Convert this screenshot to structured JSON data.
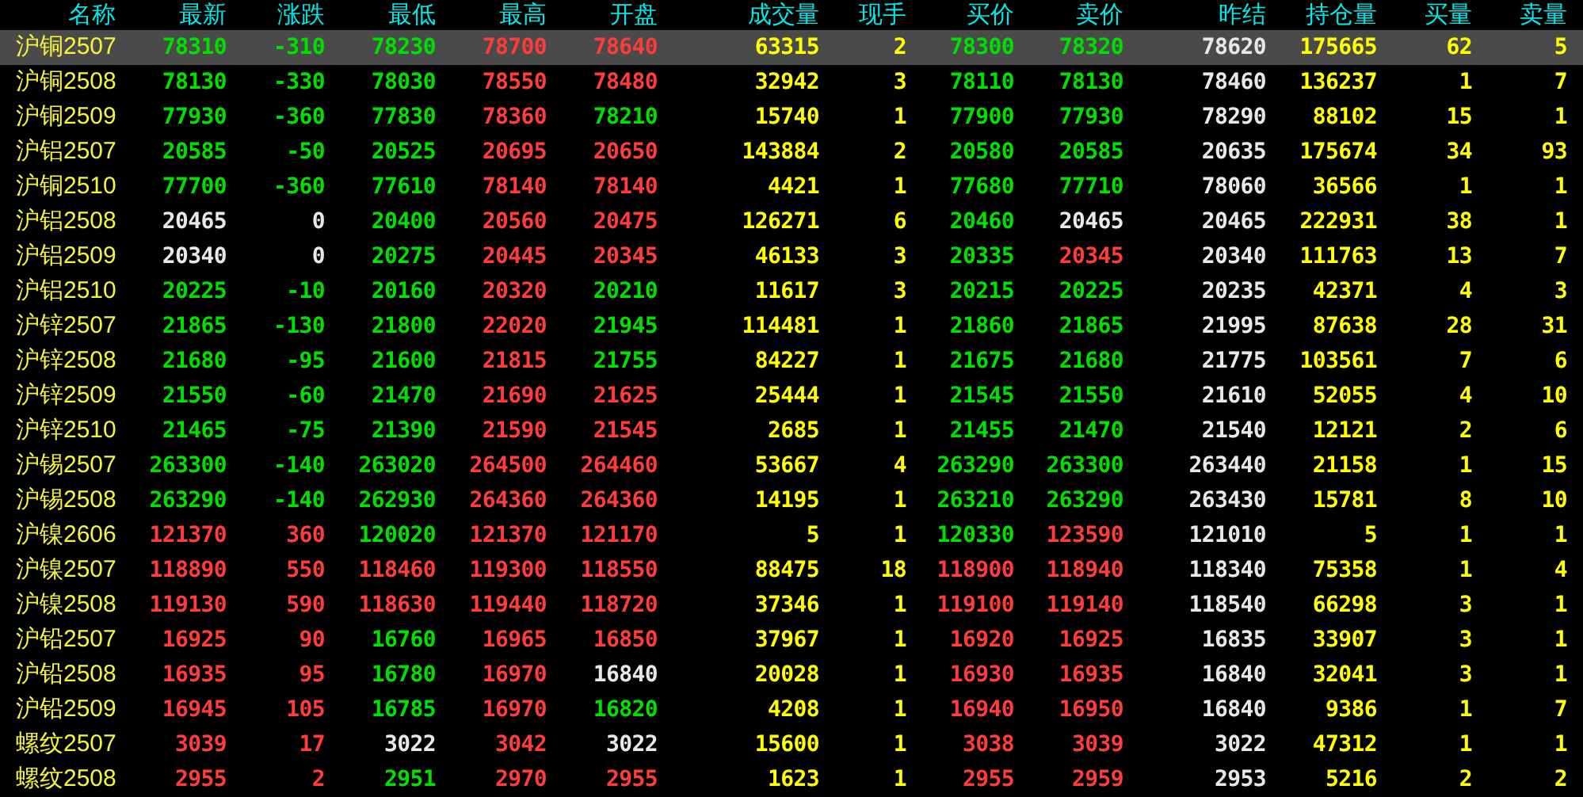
{
  "table": {
    "columns": [
      {
        "label": "名称",
        "kind": "name"
      },
      {
        "label": "最新",
        "kind": "price"
      },
      {
        "label": "涨跌",
        "kind": "change"
      },
      {
        "label": "最低",
        "kind": "price"
      },
      {
        "label": "最高",
        "kind": "price"
      },
      {
        "label": "开盘",
        "kind": "price"
      },
      {
        "label": "成交量",
        "kind": "volume"
      },
      {
        "label": "现手",
        "kind": "volume"
      },
      {
        "label": "买价",
        "kind": "price"
      },
      {
        "label": "卖价",
        "kind": "price"
      },
      {
        "label": "昨结",
        "kind": "settle"
      },
      {
        "label": "持仓量",
        "kind": "volume"
      },
      {
        "label": "买量",
        "kind": "volume"
      },
      {
        "label": "卖量",
        "kind": "volume"
      }
    ],
    "rows": [
      {
        "selected": true,
        "cells": [
          "沪铜2507",
          "78310",
          "-310",
          "78230",
          "78700",
          "78640",
          "63315",
          "2",
          "78300",
          "78320",
          "78620",
          "175665",
          "62",
          "5"
        ]
      },
      {
        "selected": false,
        "cells": [
          "沪铜2508",
          "78130",
          "-330",
          "78030",
          "78550",
          "78480",
          "32942",
          "3",
          "78110",
          "78130",
          "78460",
          "136237",
          "1",
          "7"
        ]
      },
      {
        "selected": false,
        "cells": [
          "沪铜2509",
          "77930",
          "-360",
          "77830",
          "78360",
          "78210",
          "15740",
          "1",
          "77900",
          "77930",
          "78290",
          "88102",
          "15",
          "1"
        ]
      },
      {
        "selected": false,
        "cells": [
          "沪铝2507",
          "20585",
          "-50",
          "20525",
          "20695",
          "20650",
          "143884",
          "2",
          "20580",
          "20585",
          "20635",
          "175674",
          "34",
          "93"
        ]
      },
      {
        "selected": false,
        "cells": [
          "沪铜2510",
          "77700",
          "-360",
          "77610",
          "78140",
          "78140",
          "4421",
          "1",
          "77680",
          "77710",
          "78060",
          "36566",
          "1",
          "1"
        ]
      },
      {
        "selected": false,
        "cells": [
          "沪铝2508",
          "20465",
          "0",
          "20400",
          "20560",
          "20475",
          "126271",
          "6",
          "20460",
          "20465",
          "20465",
          "222931",
          "38",
          "1"
        ]
      },
      {
        "selected": false,
        "cells": [
          "沪铝2509",
          "20340",
          "0",
          "20275",
          "20445",
          "20345",
          "46133",
          "3",
          "20335",
          "20345",
          "20340",
          "111763",
          "13",
          "7"
        ]
      },
      {
        "selected": false,
        "cells": [
          "沪铝2510",
          "20225",
          "-10",
          "20160",
          "20320",
          "20210",
          "11617",
          "3",
          "20215",
          "20225",
          "20235",
          "42371",
          "4",
          "3"
        ]
      },
      {
        "selected": false,
        "cells": [
          "沪锌2507",
          "21865",
          "-130",
          "21800",
          "22020",
          "21945",
          "114481",
          "1",
          "21860",
          "21865",
          "21995",
          "87638",
          "28",
          "31"
        ]
      },
      {
        "selected": false,
        "cells": [
          "沪锌2508",
          "21680",
          "-95",
          "21600",
          "21815",
          "21755",
          "84227",
          "1",
          "21675",
          "21680",
          "21775",
          "103561",
          "7",
          "6"
        ]
      },
      {
        "selected": false,
        "cells": [
          "沪锌2509",
          "21550",
          "-60",
          "21470",
          "21690",
          "21625",
          "25444",
          "1",
          "21545",
          "21550",
          "21610",
          "52055",
          "4",
          "10"
        ]
      },
      {
        "selected": false,
        "cells": [
          "沪锌2510",
          "21465",
          "-75",
          "21390",
          "21590",
          "21545",
          "2685",
          "1",
          "21455",
          "21470",
          "21540",
          "12121",
          "2",
          "6"
        ]
      },
      {
        "selected": false,
        "cells": [
          "沪锡2507",
          "263300",
          "-140",
          "263020",
          "264500",
          "264460",
          "53667",
          "4",
          "263290",
          "263300",
          "263440",
          "21158",
          "1",
          "15"
        ]
      },
      {
        "selected": false,
        "cells": [
          "沪锡2508",
          "263290",
          "-140",
          "262930",
          "264360",
          "264360",
          "14195",
          "1",
          "263210",
          "263290",
          "263430",
          "15781",
          "8",
          "10"
        ]
      },
      {
        "selected": false,
        "cells": [
          "沪镍2606",
          "121370",
          "360",
          "120020",
          "121370",
          "121170",
          "5",
          "1",
          "120330",
          "123590",
          "121010",
          "5",
          "1",
          "1"
        ]
      },
      {
        "selected": false,
        "cells": [
          "沪镍2507",
          "118890",
          "550",
          "118460",
          "119300",
          "118550",
          "88475",
          "18",
          "118900",
          "118940",
          "118340",
          "75358",
          "1",
          "4"
        ]
      },
      {
        "selected": false,
        "cells": [
          "沪镍2508",
          "119130",
          "590",
          "118630",
          "119440",
          "118720",
          "37346",
          "1",
          "119100",
          "119140",
          "118540",
          "66298",
          "3",
          "1"
        ]
      },
      {
        "selected": false,
        "cells": [
          "沪铅2507",
          "16925",
          "90",
          "16760",
          "16965",
          "16850",
          "37967",
          "1",
          "16920",
          "16925",
          "16835",
          "33907",
          "3",
          "1"
        ]
      },
      {
        "selected": false,
        "cells": [
          "沪铅2508",
          "16935",
          "95",
          "16780",
          "16970",
          "16840",
          "20028",
          "1",
          "16930",
          "16935",
          "16840",
          "32041",
          "3",
          "1"
        ]
      },
      {
        "selected": false,
        "cells": [
          "沪铅2509",
          "16945",
          "105",
          "16785",
          "16970",
          "16820",
          "4208",
          "1",
          "16940",
          "16950",
          "16840",
          "9386",
          "1",
          "7"
        ]
      },
      {
        "selected": false,
        "cells": [
          "螺纹2507",
          "3039",
          "17",
          "3022",
          "3042",
          "3022",
          "15600",
          "1",
          "3038",
          "3039",
          "3022",
          "47312",
          "1",
          "1"
        ]
      },
      {
        "selected": false,
        "cells": [
          "螺纹2508",
          "2955",
          "2",
          "2951",
          "2970",
          "2955",
          "1623",
          "1",
          "2955",
          "2959",
          "2953",
          "5216",
          "2",
          "2"
        ]
      }
    ]
  }
}
